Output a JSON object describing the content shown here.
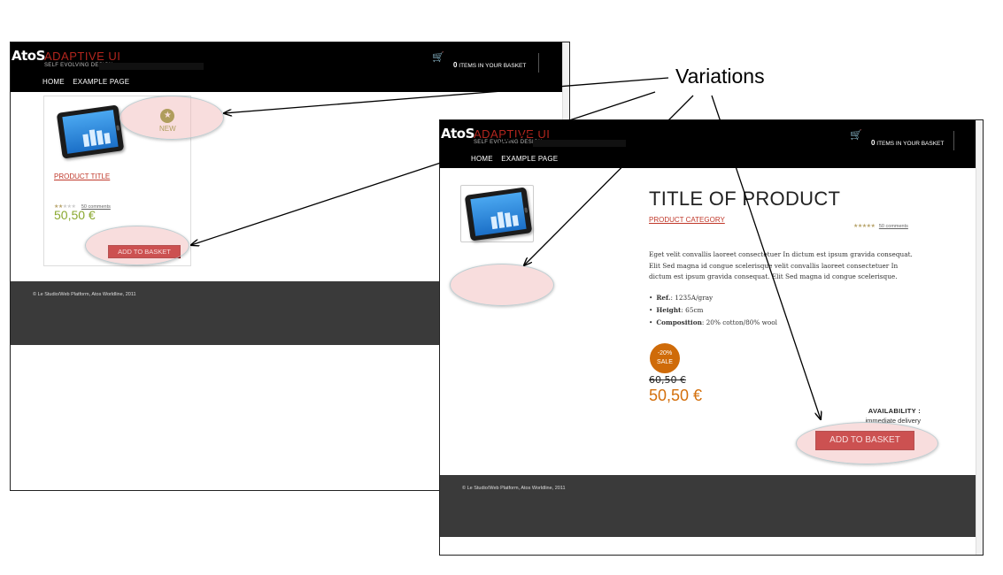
{
  "callout_label": "Variations",
  "brand": {
    "logo": "AtoS",
    "product": "ADAPTIVE UI",
    "tagline": "SELF EVOLVING DESIGN"
  },
  "nav": {
    "home": "HOME",
    "example": "EXAMPLE PAGE"
  },
  "cart": {
    "count": "0",
    "label": "ITEMS IN YOUR BASKET",
    "icon": "shopping-cart-icon"
  },
  "listing": {
    "badge": "NEW",
    "badge_icon": "star-icon",
    "product_title": "PRODUCT TITLE",
    "rating": 2,
    "comments": "50 comments",
    "price": "50,50 €",
    "add_button": "ADD TO BASKET"
  },
  "detail": {
    "title": "TITLE OF PRODUCT",
    "category": "PRODUCT CATEGORY",
    "rating": 5,
    "comments": "50 comments",
    "description": "Eget velit convallis laoreet consectetuer In dictum est ipsum gravida consequat. Elit Sed magna id congue scelerisque velit convallis laoreet consectetuer In dictum est ipsum gravida consequat. Elit Sed magna id congue scelerisque.",
    "specs": [
      {
        "label": "Ref.",
        "value": ": 1235A/gray"
      },
      {
        "label": "Height",
        "value": ": 65cm"
      },
      {
        "label": "Composition",
        "value": ": 20% cotton/80% wool"
      }
    ],
    "sale_pct": "-20%",
    "sale_label": "SALE",
    "old_price": "60,50 €",
    "price": "50,50 €",
    "availability_label": "AVAILABILITY :",
    "availability_value": "immediate delivery",
    "add_button": "ADD TO BASKET"
  },
  "footer": {
    "text": "© Le Studio/Web Platform, Atos Worldline, 2011"
  },
  "colors": {
    "accent_red": "#b00000",
    "price_green": "#8aa830",
    "price_orange": "#d4700d",
    "sale_badge": "#cf6b09",
    "footer_bg": "#3a3a3a"
  }
}
